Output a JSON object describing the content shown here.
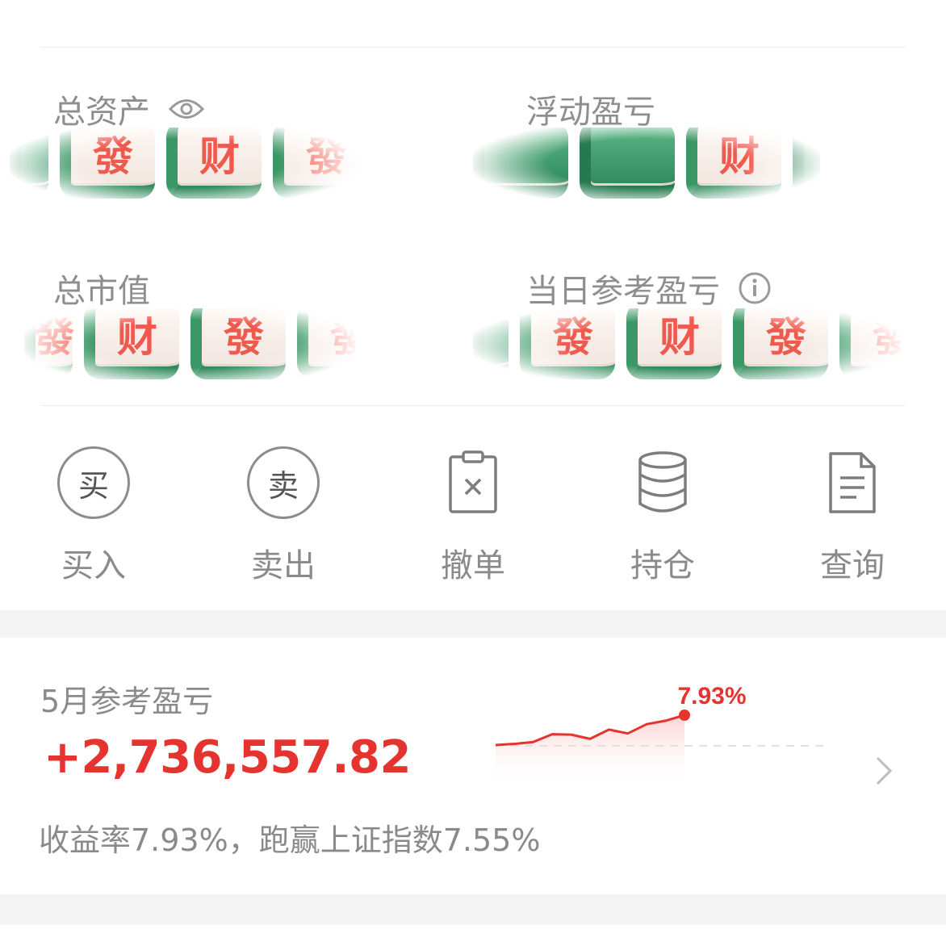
{
  "assets": {
    "total_assets_label": "总资产",
    "floating_pl_label": "浮动盈亏",
    "market_value_label": "总市值",
    "daily_pl_label": "当日参考盈亏",
    "icons": {
      "visibility": "eye-icon",
      "info": "info-icon"
    },
    "hidden_value_tiles": [
      "發",
      "财",
      "發"
    ]
  },
  "actions": [
    {
      "label": "买入",
      "icon_text": "买",
      "icon": "buy-circle-icon"
    },
    {
      "label": "卖出",
      "icon_text": "卖",
      "icon": "sell-circle-icon"
    },
    {
      "label": "撤单",
      "icon": "cancel-order-clipboard-icon"
    },
    {
      "label": "持仓",
      "icon": "holdings-database-icon"
    },
    {
      "label": "查询",
      "icon": "query-document-icon"
    }
  ],
  "monthly": {
    "title": "5月参考盈亏",
    "value": "+2,736,557.82",
    "description": "收益率7.93%，跑赢上证指数7.55%",
    "chart_label": "7.93%",
    "chevron": "chevron-right-icon"
  },
  "colors": {
    "accent_red": "#e5342f",
    "tile_green": "#2f8a5c",
    "tile_char": "#ef5a4f"
  },
  "chart_data": {
    "type": "line",
    "series": [
      {
        "values": [
          0.2,
          0.5,
          1.0,
          3.0,
          2.9,
          1.8,
          4.2,
          3.2,
          5.6,
          6.5,
          7.93
        ]
      }
    ],
    "baseline": 0,
    "end_label": "7.93%"
  }
}
